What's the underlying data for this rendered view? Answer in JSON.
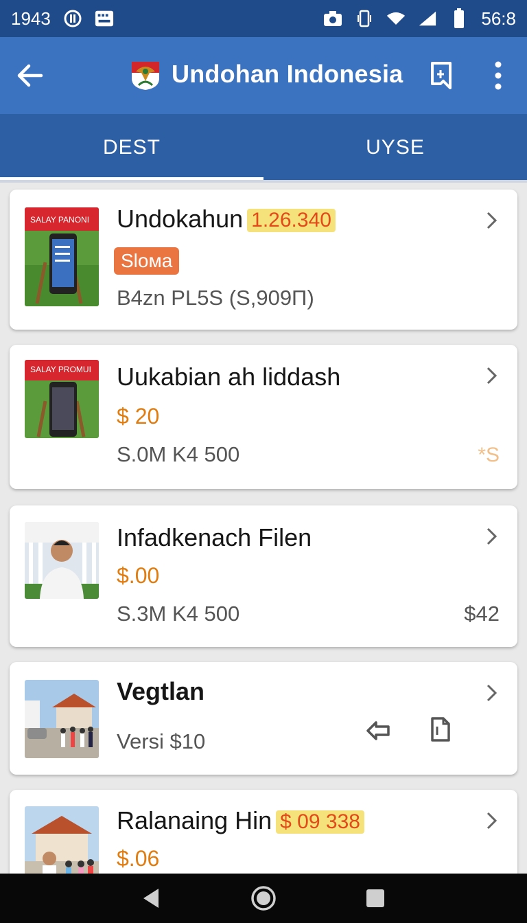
{
  "status_bar": {
    "time": "1943",
    "clock": "56:8",
    "icons": [
      "sync-icon",
      "keyboard-icon",
      "camera-icon",
      "vibrate-icon",
      "wifi-icon",
      "signal-icon",
      "battery-icon"
    ]
  },
  "app_bar": {
    "title": "Undohan Indonesia",
    "icons": [
      "back-arrow-icon",
      "garuda-logo",
      "bookmark-icon",
      "more-vert-icon"
    ]
  },
  "tabs": [
    {
      "label": "DEST",
      "active": true
    },
    {
      "label": "UYSE",
      "active": false
    }
  ],
  "items": [
    {
      "title": "Undokahun",
      "title_badge": "1.26.340",
      "tag": "Sloмa",
      "sub": "B4zn PL5S (S,909Π)",
      "thumb": "phone-on-grass",
      "thumb_banner": "SALAY PANONI"
    },
    {
      "title": "Uukabian ah liddash",
      "price": "$ 20",
      "sub": "S.0M K4 500",
      "right": "*S",
      "thumb": "phone-on-grass",
      "thumb_banner": "SALAY PROMUI"
    },
    {
      "title": "Infadkenach Filen",
      "price": "$.00",
      "sub": "S.3M K4 500",
      "right": "$42",
      "thumb": "person-portrait"
    },
    {
      "title": "Vegtlan",
      "sub": "Versi $10",
      "actions": [
        "share-icon",
        "copy-icon"
      ],
      "thumb": "crowd-street"
    },
    {
      "title": "Ralanaing Hin",
      "title_badge": "$ 09 338",
      "price": "$.06",
      "thumb": "building-people"
    }
  ],
  "colors": {
    "status_bar": "#1f4b8a",
    "app_bar": "#3c73c0",
    "tab_bar": "#2d5fa5",
    "price": "#e07c10",
    "tag": "#ea7540",
    "badge_bg": "#f5e27a",
    "background": "#e9e9e9"
  },
  "nav_bar": [
    "back-triangle-icon",
    "home-circle-icon",
    "recents-square-icon"
  ]
}
